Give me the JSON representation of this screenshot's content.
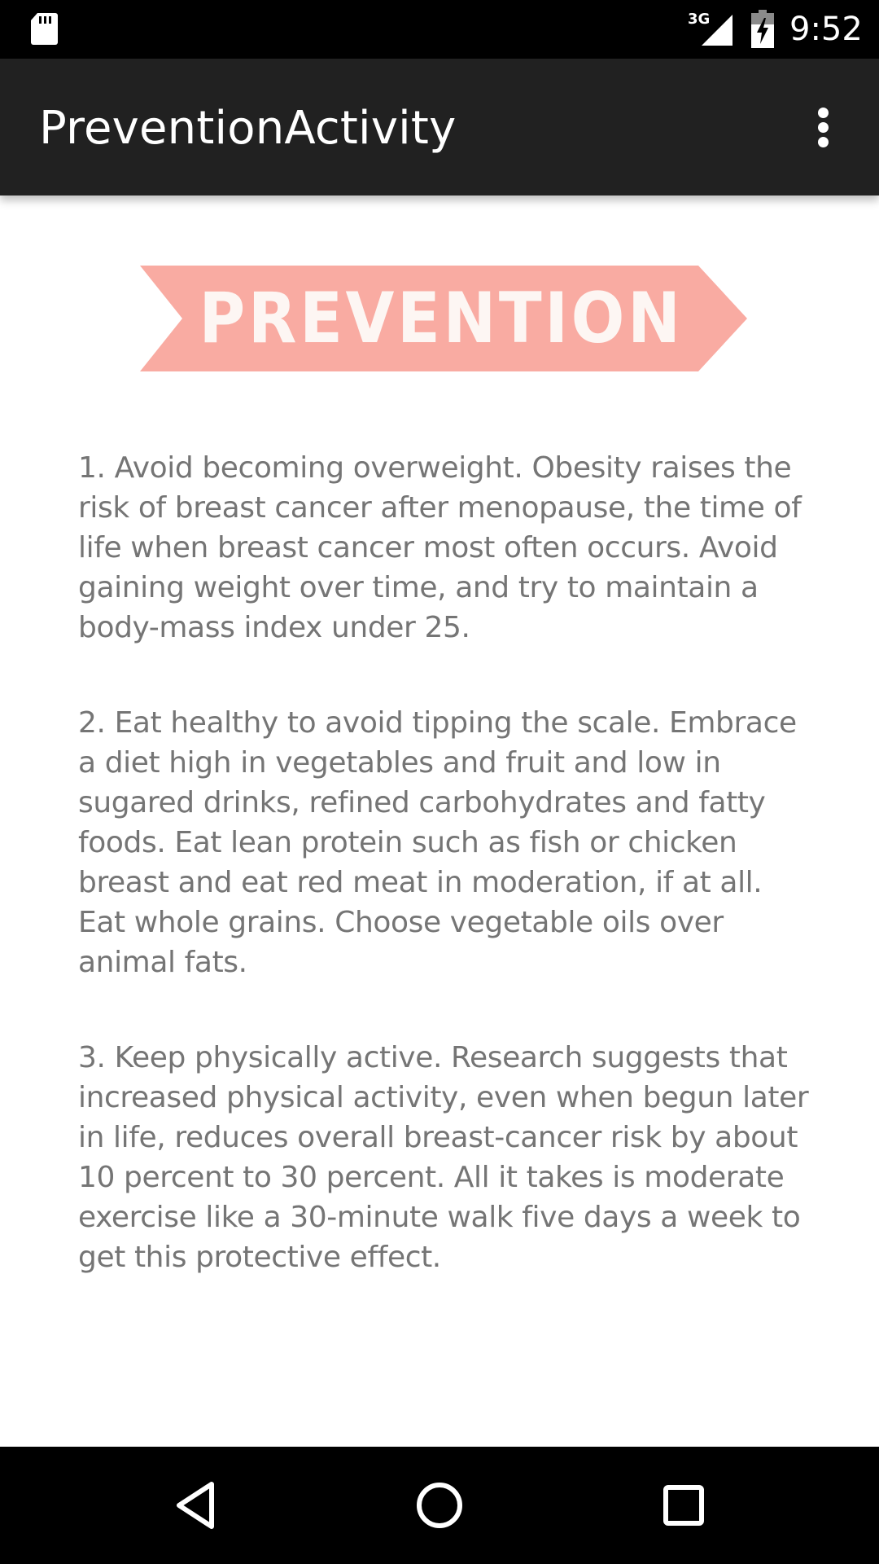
{
  "status_bar": {
    "time": "9:52",
    "network_type": "3G",
    "icons": [
      "sd-card-icon",
      "signal-icon",
      "battery-charging-icon"
    ]
  },
  "app_bar": {
    "title": "PreventionActivity",
    "overflow_icon": "more-vert-icon"
  },
  "banner": {
    "text": "PREVENTION",
    "color": "#f9aba2"
  },
  "paragraphs": [
    "1. Avoid becoming overweight. Obesity raises the risk of breast cancer after menopause, the time of life when breast cancer most often occurs. Avoid gaining weight over time, and try to maintain a body-mass index under 25.",
    "2. Eat healthy to avoid tipping the scale. Embrace a diet high in vegetables and fruit and low in sugared drinks, refined carbohydrates and fatty foods. Eat lean protein such as fish or chicken breast and eat red meat in moderation, if at all. Eat whole grains. Choose vegetable oils over animal fats.",
    "3. Keep physically active. Research suggests that increased physical activity, even when begun later in life, reduces overall breast-cancer risk by about 10 percent to 30 percent. All it takes is moderate exercise like a 30-minute walk five days a week to get this protective effect."
  ],
  "nav_bar": {
    "buttons": [
      "back-icon",
      "home-icon",
      "recents-icon"
    ]
  },
  "colors": {
    "app_bar": "#212121",
    "body_text": "#757575",
    "banner": "#f9aba2"
  }
}
